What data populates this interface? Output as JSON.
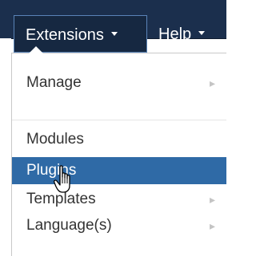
{
  "navbar": {
    "extensions_label": "Extensions",
    "help_label": "Help"
  },
  "menu": {
    "items": [
      {
        "label": "Manage",
        "has_submenu": true
      },
      {
        "label": "Modules",
        "has_submenu": false
      },
      {
        "label": "Plugins",
        "has_submenu": false,
        "highlighted": true
      },
      {
        "label": "Templates",
        "has_submenu": true
      },
      {
        "label": "Language(s)",
        "has_submenu": true
      }
    ]
  },
  "icons": {
    "submenu_indicator": "chevron-right-icon",
    "dropdown_indicator": "caret-down-icon",
    "cursor": "hand-pointer-cursor-icon"
  },
  "colors": {
    "navbar_bg": "#1b2f4d",
    "highlight_bg": "#2f6aa6",
    "menu_text": "#333333"
  }
}
